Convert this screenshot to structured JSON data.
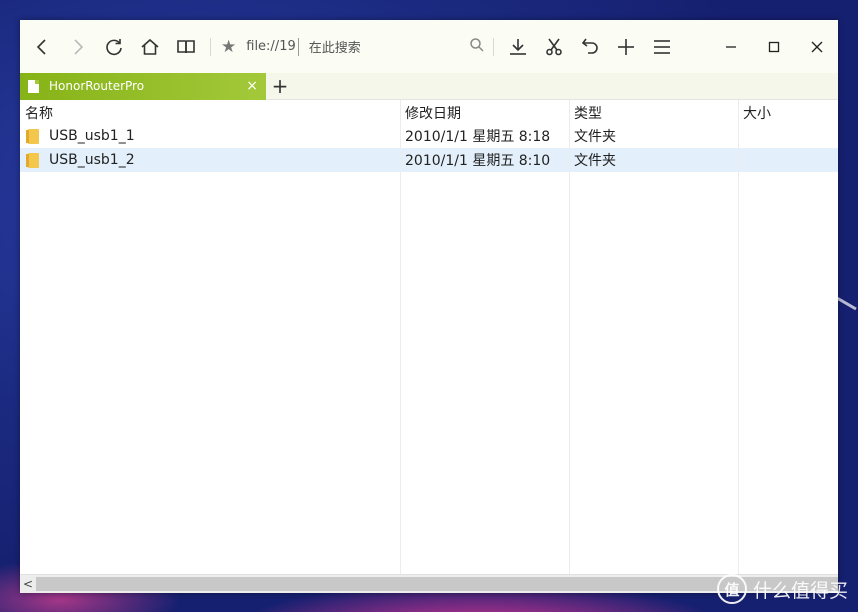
{
  "browser": {
    "url": "file://19",
    "search_placeholder": "在此搜索",
    "tab_title": "HonorRouterPro",
    "new_tab": "+",
    "tab_close": "×"
  },
  "columns": {
    "name": "名称",
    "date": "修改日期",
    "type": "类型",
    "size": "大小"
  },
  "files": [
    {
      "name": "USB_usb1_1",
      "date": "2010/1/1 星期五 8:18",
      "type": "文件夹",
      "size": "",
      "selected": false
    },
    {
      "name": "USB_usb1_2",
      "date": "2010/1/1 星期五 8:10",
      "type": "文件夹",
      "size": "",
      "selected": true
    }
  ],
  "scrollbar": {
    "left_arrow": "<"
  },
  "watermark": {
    "logo": "值",
    "text": "什么值得买"
  },
  "colors": {
    "tab_green": "#86b317",
    "selected_row": "#e3f0fb",
    "toolbar_bg": "#fbfcf4"
  }
}
